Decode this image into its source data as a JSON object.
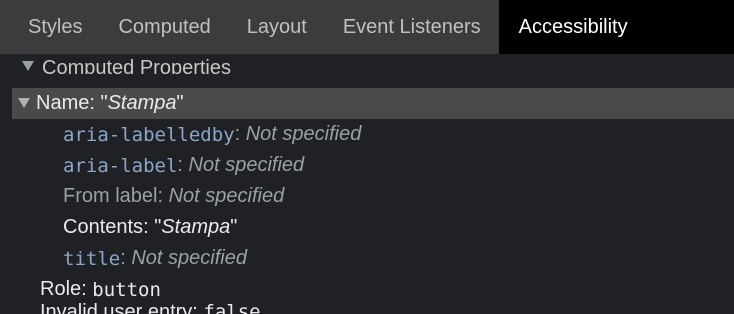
{
  "tabs": [
    {
      "label": "Styles",
      "active": false
    },
    {
      "label": "Computed",
      "active": false
    },
    {
      "label": "Layout",
      "active": false
    },
    {
      "label": "Event Listeners",
      "active": false
    },
    {
      "label": "Accessibility",
      "active": true
    }
  ],
  "section": {
    "title": "Computed Properties"
  },
  "name_row": {
    "prefix": "Name: ",
    "quote_open": "\"",
    "value": "Stampa",
    "quote_close": "\""
  },
  "properties": [
    {
      "key": "aria-labelledby",
      "sep": ": ",
      "value": "Not specified"
    },
    {
      "key": "aria-label",
      "sep": ": ",
      "value": "Not specified"
    },
    {
      "key": "From label",
      "sep": ": ",
      "value": "Not specified"
    },
    {
      "key": "Contents",
      "sep": ": ",
      "value_prefix": "\"",
      "value": "Stampa",
      "value_suffix": "\""
    },
    {
      "key": "title",
      "sep": ": ",
      "value": "Not specified"
    }
  ],
  "role": {
    "label": "Role: ",
    "value": "button"
  },
  "invalid": {
    "label": "Invalid user entry: ",
    "value": "false"
  },
  "colors": {
    "tab_bar": "#3c3c3c",
    "active_tab": "#000000",
    "panel_bg": "#202124",
    "selected_row": "#4a4a4a",
    "attr_name": "#8aa6c9",
    "dim_text": "#9aa0a6"
  }
}
